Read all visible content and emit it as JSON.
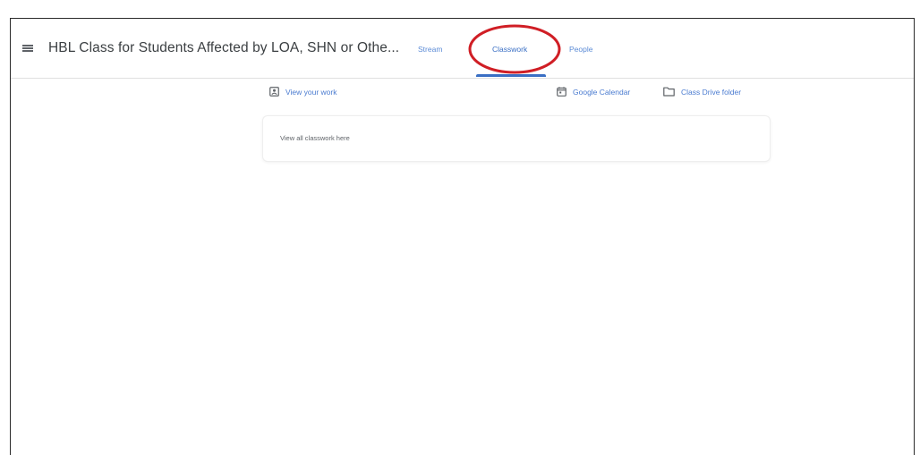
{
  "header": {
    "class_title": "HBL Class for Students Affected by LOA, SHN or Othe...",
    "tabs": [
      {
        "label": "Stream",
        "active": false
      },
      {
        "label": "Classwork",
        "active": true
      },
      {
        "label": "People",
        "active": false
      }
    ]
  },
  "actions": {
    "view_your_work": "View your work",
    "google_calendar": "Google Calendar",
    "class_drive_folder": "Class Drive folder"
  },
  "card": {
    "text": "View all classwork here"
  },
  "icons": {
    "menu": "menu-icon",
    "view_your_work": "assignment-person-icon",
    "google_calendar": "calendar-icon",
    "class_drive_folder": "folder-icon"
  },
  "colors": {
    "accent_blue": "#3a6fc4",
    "highlight_red": "#d01e25",
    "title_text": "#3c4043"
  }
}
